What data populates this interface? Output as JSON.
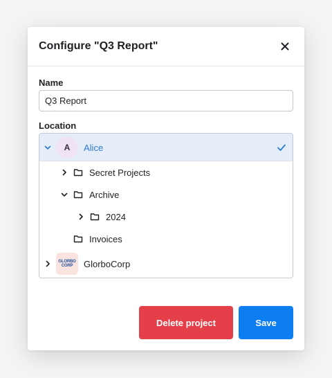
{
  "dialog": {
    "title": "Configure \"Q3 Report\"",
    "close_icon": "close-icon"
  },
  "form": {
    "name_label": "Name",
    "name_value": "Q3 Report",
    "location_label": "Location"
  },
  "tree": {
    "items": [
      {
        "label": "Alice",
        "avatar": "A",
        "expanded": true,
        "selected": true
      },
      {
        "label": "Secret Projects",
        "icon": "folder-icon",
        "expanded": false
      },
      {
        "label": "Archive",
        "icon": "folder-icon",
        "expanded": true
      },
      {
        "label": "2024",
        "icon": "folder-icon",
        "expanded": false
      },
      {
        "label": "Invoices",
        "icon": "folder-icon"
      },
      {
        "label": "GlorboCorp",
        "logo": [
          "GLORBO",
          "CORP"
        ],
        "expanded": false
      }
    ]
  },
  "actions": {
    "delete_label": "Delete project",
    "save_label": "Save"
  },
  "colors": {
    "accent": "#0d7df2",
    "danger": "#e5404a",
    "selected_bg": "#e5edf8",
    "selected_text": "#2a7ad3"
  }
}
